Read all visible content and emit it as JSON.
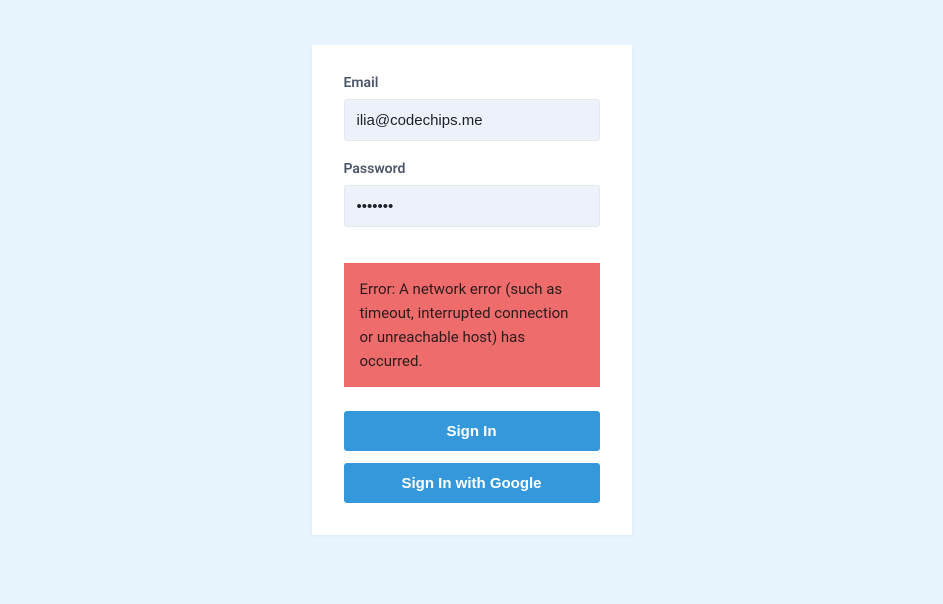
{
  "form": {
    "email": {
      "label": "Email",
      "value": "ilia@codechips.me"
    },
    "password": {
      "label": "Password",
      "value": "•••••••"
    },
    "error": "Error: A network error (such as timeout, interrupted connection or unreachable host) has occurred.",
    "signInLabel": "Sign In",
    "signInGoogleLabel": "Sign In with Google"
  }
}
